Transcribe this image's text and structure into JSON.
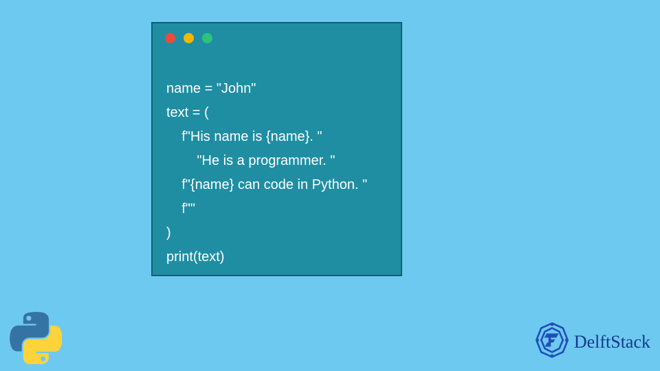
{
  "code": {
    "lines": [
      "name = \"John\"",
      "text = (",
      "    f\"His name is {name}. \"",
      "        \"He is a programmer. \"",
      "    f\"{name} can code in Python. \"",
      "    f\"\"",
      ")",
      "print(text)"
    ]
  },
  "brand": {
    "name": "DelftStack"
  },
  "icons": {
    "python": "python-logo",
    "delft": "delft-emblem"
  },
  "colors": {
    "background": "#6EC9F0",
    "window_bg": "#1F8EA3",
    "window_border": "#0E5F75",
    "code_text": "#FFFFFF",
    "dot_red": "#E94B3C",
    "dot_yellow": "#F5B700",
    "dot_green": "#2EC27E",
    "brand_text": "#143A8C"
  }
}
